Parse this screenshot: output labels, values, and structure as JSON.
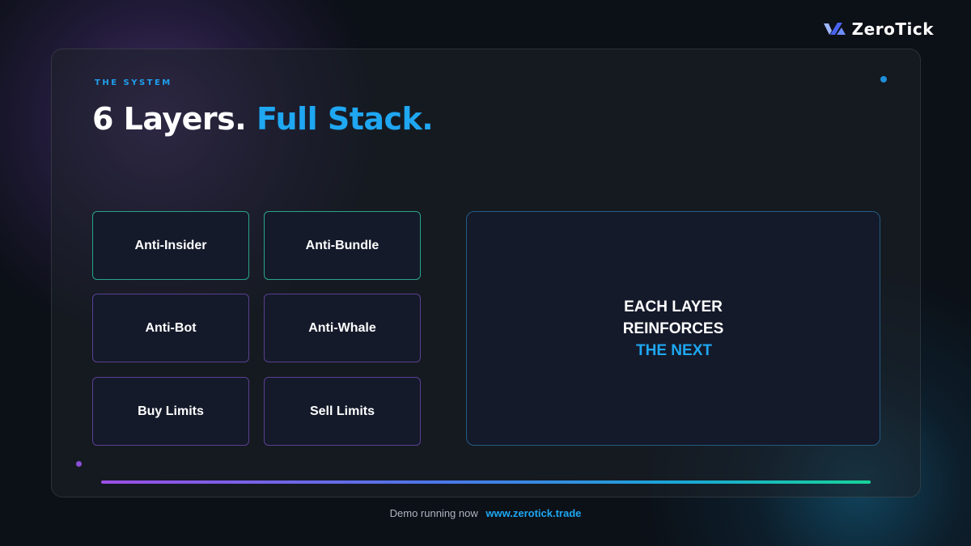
{
  "brand": {
    "name": "ZeroTick",
    "logo_icon": "zerotick-logo-icon",
    "colors": {
      "accent": "#1fa7f2",
      "mark_light": "#9fb7ff",
      "mark_dark": "#4a63f0"
    }
  },
  "slide": {
    "kicker": "THE SYSTEM",
    "title_main": "6 Layers.",
    "title_accent": "Full Stack."
  },
  "layers": [
    {
      "label": "Anti-Insider",
      "border": "#2aa38a"
    },
    {
      "label": "Anti-Bundle",
      "border": "#2aa38a"
    },
    {
      "label": "Anti-Bot",
      "border": "#5a3f90"
    },
    {
      "label": "Anti-Whale",
      "border": "#5a3f90"
    },
    {
      "label": "Buy Limits",
      "border": "#5a3f90"
    },
    {
      "label": "Sell Limits",
      "border": "#5a3f90"
    }
  ],
  "callout": {
    "line1": "EACH LAYER",
    "line2": "REINFORCES",
    "line3": "THE NEXT"
  },
  "footer": {
    "text": "Demo running now",
    "link": "www.zerotick.trade"
  },
  "colors": {
    "background": "#0c1017",
    "panel": "#1e222a",
    "card": "#141a2a",
    "gradient_start": "#9b4fe6",
    "gradient_end": "#19d39a"
  }
}
